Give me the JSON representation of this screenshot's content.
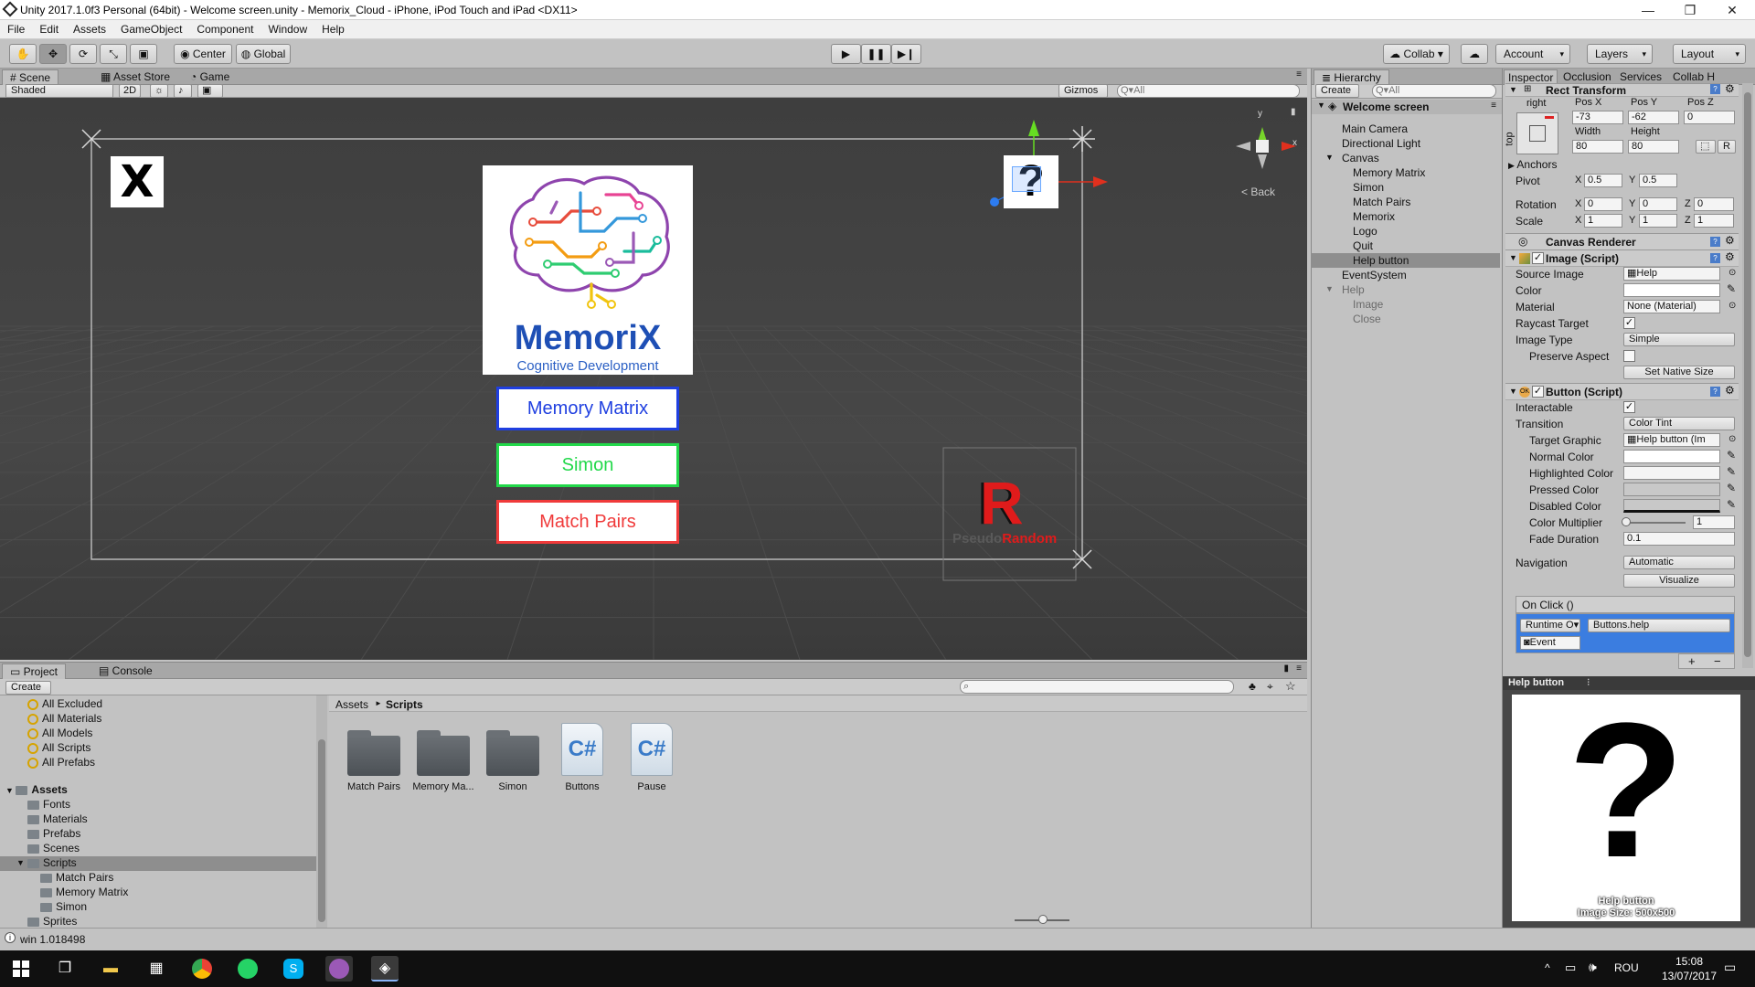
{
  "window": {
    "title": "Unity 2017.1.0f3 Personal (64bit) - Welcome screen.unity - Memorix_Cloud - iPhone, iPod Touch and iPad <DX11>",
    "minimize": "—",
    "maximize": "❐",
    "close": "✕"
  },
  "menu": [
    "File",
    "Edit",
    "Assets",
    "GameObject",
    "Component",
    "Window",
    "Help"
  ],
  "toolbar": {
    "center_label": "Center",
    "global_label": "Global",
    "collab_label": "Collab ▾",
    "account_label": "Account",
    "layers_label": "Layers",
    "layout_label": "Layout"
  },
  "scene_panel": {
    "tabs": [
      "Scene",
      "Asset Store",
      "Game"
    ],
    "shading": "Shaded",
    "mode_2d": "2D",
    "gizmos_label": "Gizmos",
    "search_placeholder": "Q▾All",
    "back_label": "< Back",
    "close_glyph": "X",
    "help_glyph": "?",
    "logo": {
      "title": "MemoriX",
      "subtitle": "Cognitive Development"
    },
    "buttons": [
      {
        "label": "Memory Matrix",
        "color": "#1f3fe0"
      },
      {
        "label": "Simon",
        "color": "#22d84a"
      },
      {
        "label": "Match Pairs",
        "color": "#f03a3a"
      }
    ],
    "random_logo": {
      "letter": "R",
      "word_a": "Pseudo",
      "word_b": "Random"
    }
  },
  "hierarchy": {
    "tab": "Hierarchy",
    "create_label": "Create",
    "search_placeholder": "Q▾All",
    "scene_name": "Welcome screen",
    "items": [
      {
        "label": "Main Camera",
        "indent": 1
      },
      {
        "label": "Directional Light",
        "indent": 1
      },
      {
        "label": "Canvas",
        "indent": 1,
        "expanded": true
      },
      {
        "label": "Memory Matrix",
        "indent": 2
      },
      {
        "label": "Simon",
        "indent": 2
      },
      {
        "label": "Match Pairs",
        "indent": 2
      },
      {
        "label": "Memorix",
        "indent": 2
      },
      {
        "label": "Logo",
        "indent": 2
      },
      {
        "label": "Quit",
        "indent": 2
      },
      {
        "label": "Help button",
        "indent": 2,
        "selected": true
      },
      {
        "label": "EventSystem",
        "indent": 1
      },
      {
        "label": "Help",
        "indent": 1,
        "expanded": true,
        "inactive": true
      },
      {
        "label": "Image",
        "indent": 2,
        "inactive": true
      },
      {
        "label": "Close",
        "indent": 2,
        "inactive": true
      }
    ]
  },
  "inspector": {
    "tabs": [
      "Inspector",
      "Occlusion",
      "Services",
      "Collab H"
    ],
    "rect_transform": {
      "title": "Rect Transform",
      "anchor_h": "right",
      "anchor_v": "top",
      "pos_x_label": "Pos X",
      "pos_y_label": "Pos Y",
      "pos_z_label": "Pos Z",
      "pos_x": "-73",
      "pos_y": "-62",
      "pos_z": "0",
      "width_label": "Width",
      "height_label": "Height",
      "width": "80",
      "height": "80",
      "r_label": "R",
      "anchors_label": "Anchors",
      "pivot_label": "Pivot",
      "pivot_x": "0.5",
      "pivot_y": "0.5",
      "rotation_label": "Rotation",
      "rot_x": "0",
      "rot_y": "0",
      "rot_z": "0",
      "scale_label": "Scale",
      "scale_x": "1",
      "scale_y": "1",
      "scale_z": "1"
    },
    "canvas_renderer": {
      "title": "Canvas Renderer"
    },
    "image_script": {
      "title": "Image (Script)",
      "source_image_label": "Source Image",
      "source_image": "Help",
      "color_label": "Color",
      "material_label": "Material",
      "material": "None (Material)",
      "raycast_label": "Raycast Target",
      "image_type_label": "Image Type",
      "image_type": "Simple",
      "preserve_label": "Preserve Aspect",
      "native_size_label": "Set Native Size"
    },
    "button_script": {
      "title": "Button (Script)",
      "interactable_label": "Interactable",
      "transition_label": "Transition",
      "transition": "Color Tint",
      "target_graphic_label": "Target Graphic",
      "target_graphic": "Help button (Im",
      "normal_label": "Normal Color",
      "highlighted_label": "Highlighted Color",
      "pressed_label": "Pressed Color",
      "disabled_label": "Disabled Color",
      "multiplier_label": "Color Multiplier",
      "multiplier": "1",
      "fade_label": "Fade Duration",
      "fade": "0.1",
      "navigation_label": "Navigation",
      "navigation": "Automatic",
      "visualize_label": "Visualize",
      "onclick_label": "On Click ()",
      "runtime_label": "Runtime O▾",
      "function_label": "Buttons.help",
      "event_label": "Event",
      "plus": "+",
      "minus": "−"
    },
    "preview": {
      "title": "Help button",
      "caption_1": "Help button",
      "caption_2": "Image Size: 500x500",
      "glyph": "?"
    }
  },
  "project": {
    "tabs": [
      "Project",
      "Console"
    ],
    "create_label": "Create",
    "favorites": [
      "All Excluded",
      "All Materials",
      "All Models",
      "All Scripts",
      "All Prefabs"
    ],
    "assets_root": "Assets",
    "folders": [
      {
        "label": "Fonts",
        "indent": 1
      },
      {
        "label": "Materials",
        "indent": 1
      },
      {
        "label": "Prefabs",
        "indent": 1
      },
      {
        "label": "Scenes",
        "indent": 1
      },
      {
        "label": "Scripts",
        "indent": 1,
        "selected": true
      },
      {
        "label": "Match Pairs",
        "indent": 2
      },
      {
        "label": "Memory Matrix",
        "indent": 2
      },
      {
        "label": "Simon",
        "indent": 2
      },
      {
        "label": "Sprites",
        "indent": 1
      }
    ],
    "breadcrumb_root": "Assets",
    "breadcrumb_current": "Scripts",
    "breadcrumb_sep": "►",
    "grid_items": [
      {
        "label": "Match Pairs",
        "kind": "folder"
      },
      {
        "label": "Memory Ma...",
        "kind": "folder"
      },
      {
        "label": "Simon",
        "kind": "folder"
      },
      {
        "label": "Buttons",
        "kind": "script"
      },
      {
        "label": "Pause",
        "kind": "script"
      }
    ],
    "cs_glyph": "C#"
  },
  "status": {
    "message": "win 1.018498"
  },
  "taskbar": {
    "time": "15:08",
    "date": "13/07/2017",
    "lang": "ROU"
  }
}
